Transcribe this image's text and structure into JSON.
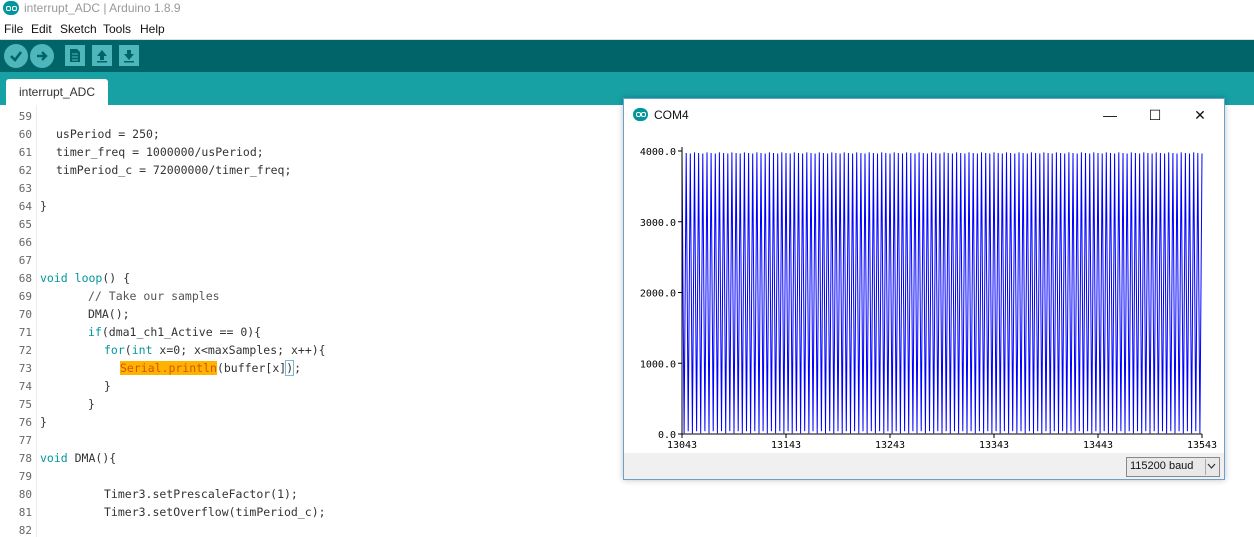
{
  "window": {
    "title": "interrupt_ADC | Arduino 1.8.9"
  },
  "menu": [
    "File",
    "Edit",
    "Sketch",
    "Tools",
    "Help"
  ],
  "toolbar": {
    "buttons": [
      "verify-icon",
      "upload-icon",
      "new-icon",
      "open-icon",
      "save-icon"
    ]
  },
  "tab": {
    "label": "interrupt_ADC"
  },
  "editor": {
    "line_numbers": [
      "59",
      "60",
      "61",
      "62",
      "63",
      "64",
      "65",
      "66",
      "67",
      "68",
      "69",
      "70",
      "71",
      "72",
      "73",
      "74",
      "75",
      "76",
      "77",
      "78",
      "79",
      "80",
      "81",
      "82"
    ],
    "lines": {
      "l60": "usPeriod = 250;",
      "l61": "timer_freq = 1000000/usPeriod;",
      "l62": "timPeriod_c = 72000000/timer_freq;",
      "l64": "}",
      "l68_kw": "void",
      "l68_fn": "loop",
      "l68_rest": "() {",
      "l69": "// Take our samples",
      "l70": "DMA();",
      "l71_kw": "if",
      "l71_rest": "(dma1_ch1_Active == 0){",
      "l72_kw": "for",
      "l72_paren": "(",
      "l72_int": "int",
      "l72_rest": " x=0; x<maxSamples; x++){",
      "l73_hl": "Serial.println",
      "l73_rest": "(buffer[x]",
      "l73_close": ")",
      "l73_end": ";",
      "l74": "}",
      "l75": "}",
      "l76": "}",
      "l78_kw": "void",
      "l78_rest": " DMA(){",
      "l80": "Timer3.setPrescaleFactor(1);",
      "l81": "Timer3.setOverflow(timPeriod_c);"
    }
  },
  "serial_plotter": {
    "title": "COM4",
    "window_controls": {
      "minimize": "—",
      "maximize": "☐",
      "close": "✕"
    },
    "baud": "115200 baud",
    "colors": {
      "series": "#0000ff",
      "logo": "#00979c"
    }
  },
  "chart_data": {
    "type": "line",
    "x_range": [
      13043,
      13543
    ],
    "ylim": [
      0,
      4000
    ],
    "xticks": [
      "13043",
      "13143",
      "13243",
      "13343",
      "13443",
      "13543"
    ],
    "yticks": [
      "0.0",
      "1000.0",
      "2000.0",
      "3000.0",
      "4000.0"
    ],
    "series": [
      {
        "values": {
          "min": 10,
          "max": 3980,
          "cycles": 125,
          "description": "alternating near 0 and ~3980, dense oscillation"
        }
      }
    ],
    "grid": false
  }
}
